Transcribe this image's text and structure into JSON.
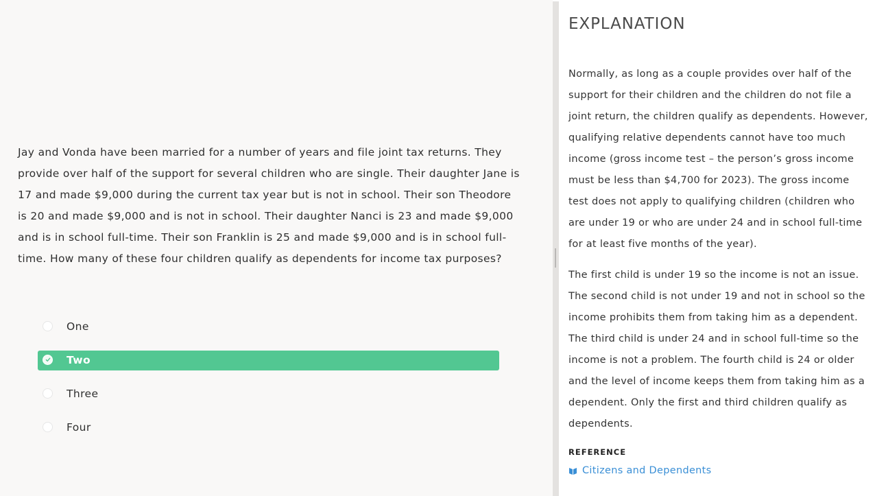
{
  "question": {
    "text": "Jay and Vonda have been married for a number of years and file joint tax returns. They provide over half of the support for several children who are single. Their daughter Jane is 17 and made $9,000 during the current tax year but is not in school. Their son Theodore is 20 and made $9,000 and is not in school. Their daughter Nanci is 23 and made $9,000 and is in school full-time. Their son Franklin is 25 and made $9,000 and is in school full-time. How many of these four children qualify as dependents for income tax purposes?",
    "answers": [
      {
        "label": "One",
        "selected": false
      },
      {
        "label": "Two",
        "selected": true
      },
      {
        "label": "Three",
        "selected": false
      },
      {
        "label": "Four",
        "selected": false
      }
    ]
  },
  "explanation": {
    "title": "EXPLANATION",
    "paragraph1": "Normally, as long as a couple provides over half of the support for their children and the children do not file a joint return, the children qualify as dependents. However, qualifying relative dependents cannot have too much income (gross income test – the person’s gross income must be less than $4,700 for 2023). The gross income test does not apply to qualifying children (children who are under 19 or who are under 24 and in school full-time for at least five months of the year).",
    "paragraph2": "The first child is under 19 so the income is not an issue. The second child is not under 19 and not in school so the income prohibits them from taking him as a dependent. The third child is under 24 and in school full-time so the income is not a problem. The fourth child is 24 or older and the level of income keeps them from taking him as a dependent. Only the first and third children qualify as dependents.",
    "reference_heading": "REFERENCE",
    "reference_link": "Citizens and Dependents",
    "reference_icon": "book-icon"
  },
  "colors": {
    "selected_answer": "#52c792",
    "link": "#3a8fd6"
  }
}
